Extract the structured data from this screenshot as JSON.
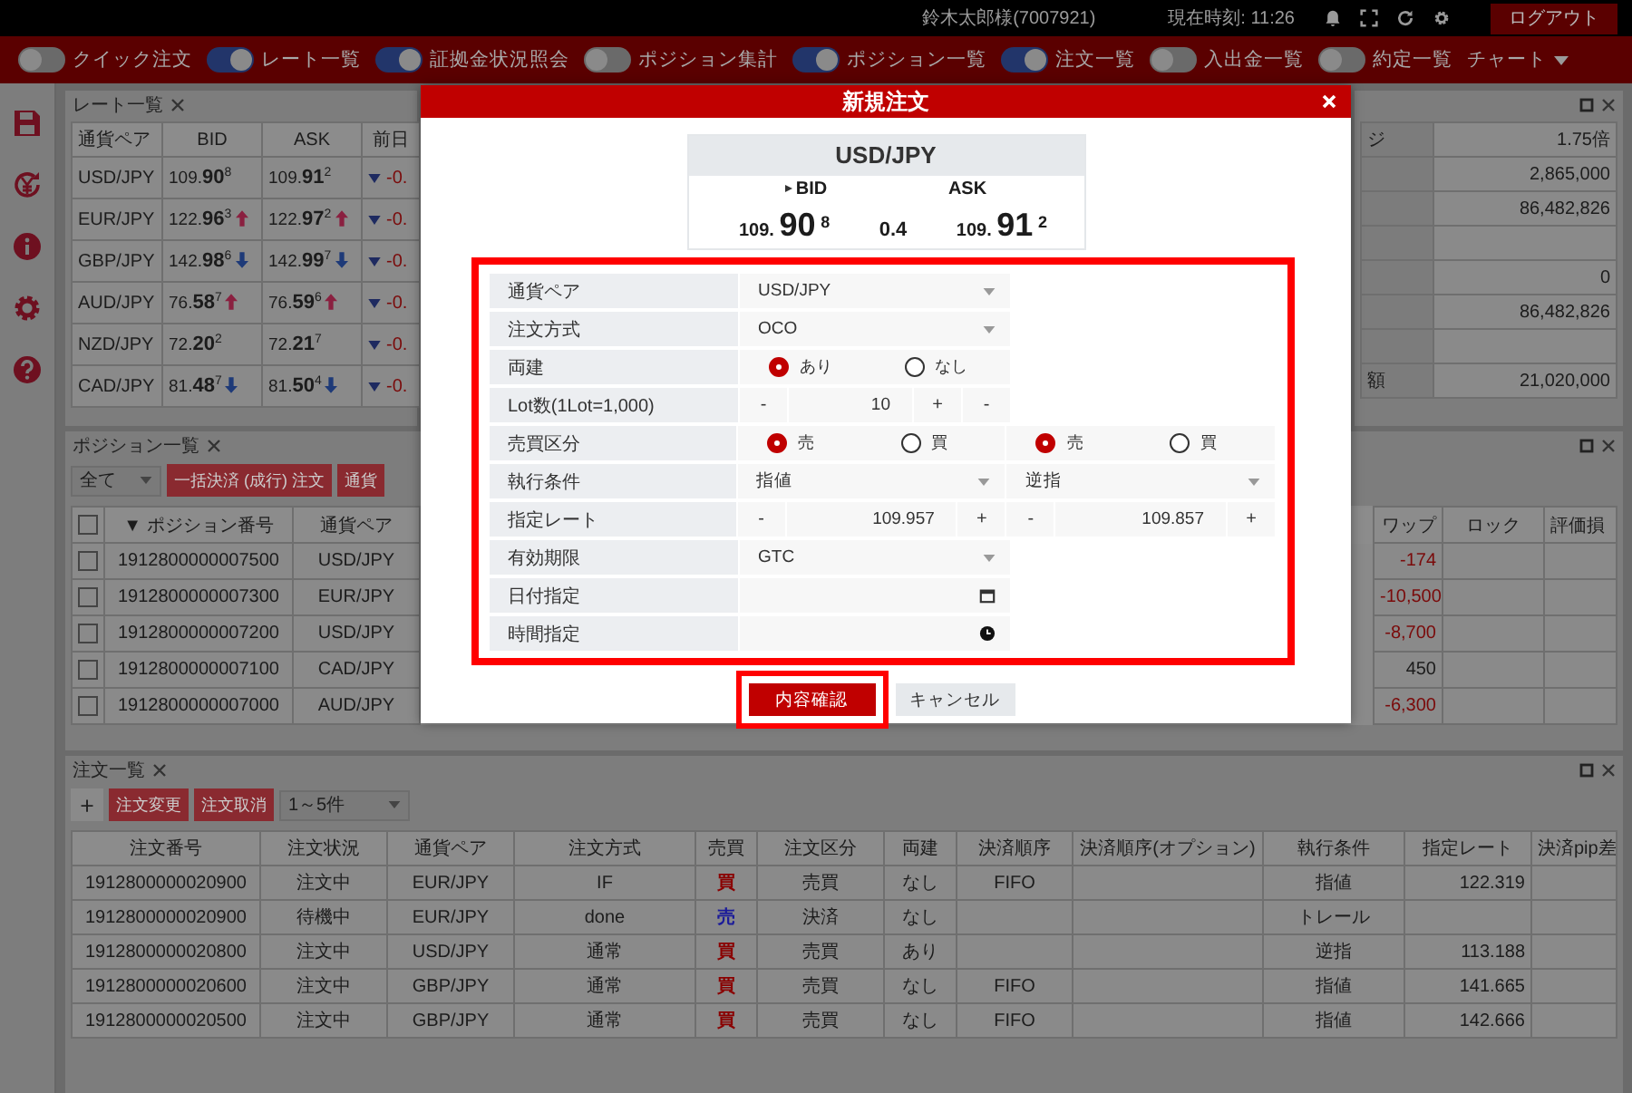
{
  "header": {
    "user": "鈴木太郎様(7007921)",
    "clock": "現在時刻: 11:26",
    "logout": "ログアウト"
  },
  "toolbar": [
    {
      "kind": "toggle",
      "label": "クイック注文",
      "on": false
    },
    {
      "kind": "toggle",
      "label": "レート一覧",
      "on": true
    },
    {
      "kind": "toggle",
      "label": "証拠金状況照会",
      "on": true
    },
    {
      "kind": "toggle",
      "label": "ポジション集計",
      "on": false
    },
    {
      "kind": "toggle",
      "label": "ポジション一覧",
      "on": true
    },
    {
      "kind": "toggle",
      "label": "注文一覧",
      "on": true
    },
    {
      "kind": "toggle",
      "label": "入出金一覧",
      "on": false
    },
    {
      "kind": "toggle",
      "label": "約定一覧",
      "on": false
    },
    {
      "kind": "menu",
      "label": "チャート"
    }
  ],
  "rate_panel": {
    "title": "レート一覧",
    "columns": [
      "通貨ペア",
      "BID",
      "ASK",
      "前日"
    ],
    "rows": [
      {
        "pair": "USD/JPY",
        "bid": "109.**90**$^{8}$",
        "bid_up": false,
        "bid_down": false,
        "ask": "109.**91**$^{2}$",
        "ask_up": false,
        "ask_down": false,
        "change": "-0."
      },
      {
        "pair": "EUR/JPY",
        "bid": "122.**96**$^{3}$",
        "bid_up": true,
        "bid_down": false,
        "ask": "122.**97**$^{2}$",
        "ask_up": true,
        "ask_down": false,
        "change": "-0."
      },
      {
        "pair": "GBP/JPY",
        "bid": "142.**98**$^{6}$",
        "bid_up": false,
        "bid_down": true,
        "ask": "142.**99**$^{7}$",
        "ask_up": false,
        "ask_down": true,
        "change": "-0."
      },
      {
        "pair": "AUD/JPY",
        "bid": "76.**58**$^{7}$",
        "bid_up": true,
        "bid_down": false,
        "ask": "76.**59**$^{6}$",
        "ask_up": true,
        "ask_down": false,
        "change": "-0."
      },
      {
        "pair": "NZD/JPY",
        "bid": "72.**20**$^{2}$",
        "bid_up": false,
        "bid_down": false,
        "ask": "72.**21**$^{7}$",
        "ask_up": false,
        "ask_down": false,
        "change": "-0."
      },
      {
        "pair": "CAD/JPY",
        "bid": "81.**48**$^{7}$",
        "bid_up": false,
        "bid_down": true,
        "ask": "81.**50**$^{4}$",
        "ask_up": false,
        "ask_down": true,
        "change": "-0."
      }
    ]
  },
  "account_panel": {
    "rows": [
      {
        "label": "ジ",
        "value": "1.75倍"
      },
      {
        "value": "2,865,000"
      },
      {
        "value": "86,482,826"
      },
      {},
      {
        "value": "0"
      },
      {
        "value": "86,482,826"
      },
      {},
      {
        "label": "額",
        "value": "21,020,000"
      }
    ]
  },
  "position_panel": {
    "title": "ポジション一覧",
    "filter": "全て",
    "all_checked": false,
    "buttons": [
      "一括決済 (成行) 注文",
      "通貨"
    ],
    "columns": [
      "▼ ポジション番号",
      "通貨ペア",
      "ワップ",
      "ロック",
      "評価損"
    ],
    "rows": [
      {
        "checked": false,
        "number": "1912800000007500",
        "pair": "USD/JPY",
        "swap": "-174",
        "color": "#7a0a0a"
      },
      {
        "checked": false,
        "number": "1912800000007300",
        "pair": "EUR/JPY",
        "swap": "-10,500",
        "color": "#7a0a0a"
      },
      {
        "checked": false,
        "number": "1912800000007200",
        "pair": "USD/JPY",
        "swap": "-8,700",
        "color": "#7a0a0a"
      },
      {
        "checked": false,
        "number": "1912800000007100",
        "pair": "CAD/JPY",
        "swap": "450",
        "color": "#1c1c1c"
      },
      {
        "checked": false,
        "number": "1912800000007000",
        "pair": "AUD/JPY",
        "swap": "-6,300",
        "color": "#7a0a0a"
      }
    ]
  },
  "order_panel": {
    "title": "注文一覧",
    "add": "+",
    "buttons": [
      "注文変更",
      "注文取消"
    ],
    "range": "1～5件",
    "columns": [
      "注文番号",
      "注文状況",
      "通貨ペア",
      "注文方式",
      "売買",
      "注文区分",
      "両建",
      "決済順序",
      "決済順序(オプション)",
      "執行条件",
      "指定レート",
      "決済pip差"
    ],
    "rows": [
      {
        "number": "1912800000020900",
        "status": "注文中",
        "pair": "EUR/JPY",
        "method": "IF",
        "side": "買",
        "color": "#8a0000",
        "category": "売買",
        "hedge": "なし",
        "settle": "FIFO",
        "condition": "指値",
        "rate": "122.319"
      },
      {
        "number": "1912800000020900",
        "status": "待機中",
        "pair": "EUR/JPY",
        "method": "done",
        "side": "売",
        "color": "#1a1a9a",
        "category": "決済",
        "hedge": "なし",
        "condition": "トレール"
      },
      {
        "number": "1912800000020800",
        "status": "注文中",
        "pair": "USD/JPY",
        "method": "通常",
        "side": "買",
        "color": "#8a0000",
        "category": "売買",
        "hedge": "あり",
        "condition": "逆指",
        "rate": "113.188"
      },
      {
        "number": "1912800000020600",
        "status": "注文中",
        "pair": "GBP/JPY",
        "method": "通常",
        "side": "買",
        "color": "#8a0000",
        "category": "売買",
        "hedge": "なし",
        "settle": "FIFO",
        "condition": "指値",
        "rate": "141.665"
      },
      {
        "number": "1912800000020500",
        "status": "注文中",
        "pair": "GBP/JPY",
        "method": "通常",
        "side": "買",
        "color": "#8a0000",
        "category": "売買",
        "hedge": "なし",
        "settle": "FIFO",
        "condition": "指値",
        "rate": "142.666"
      }
    ]
  },
  "modal": {
    "title": "新規注文",
    "quote": {
      "pair": "USD/JPY",
      "bid_label": "BID",
      "ask_label": "ASK",
      "bid_base": "109.",
      "bid_big": "90",
      "bid_pip": "8",
      "spread": "0.4",
      "ask_base": "109.",
      "ask_big": "91",
      "ask_pip": "2"
    },
    "form": [
      {
        "label": "通貨ペア",
        "controls": [
          {
            "kind": "select",
            "value": "USD/JPY"
          }
        ]
      },
      {
        "label": "注文方式",
        "controls": [
          {
            "kind": "select",
            "value": "OCO"
          }
        ]
      },
      {
        "label": "両建",
        "controls": [
          {
            "kind": "radio",
            "options": [
              {
                "label": "あり",
                "selected": true
              },
              {
                "label": "なし",
                "selected": false
              }
            ]
          }
        ]
      },
      {
        "label": "Lot数(1Lot=1,000)",
        "controls": [
          {
            "kind": "stepper",
            "minus": "-",
            "value": "10",
            "plus": "+",
            "extra": "-"
          }
        ]
      },
      {
        "label": "売買区分",
        "controls": [
          {
            "kind": "radio",
            "options": [
              {
                "label": "売",
                "selected": true
              },
              {
                "label": "買",
                "selected": false
              }
            ]
          },
          {
            "kind": "radio",
            "options": [
              {
                "label": "売",
                "selected": true
              },
              {
                "label": "買",
                "selected": false
              }
            ]
          }
        ]
      },
      {
        "label": "執行条件",
        "controls": [
          {
            "kind": "select",
            "value": "指値"
          },
          {
            "kind": "select",
            "value": "逆指"
          }
        ]
      },
      {
        "label": "指定レート",
        "controls": [
          {
            "kind": "stepper",
            "minus": "-",
            "value": "109.957",
            "plus": "+"
          },
          {
            "kind": "stepper",
            "minus": "-",
            "value": "109.857",
            "plus": "+"
          }
        ]
      },
      {
        "label": "有効期限",
        "controls": [
          {
            "kind": "select",
            "value": "GTC"
          }
        ]
      },
      {
        "label": "日付指定",
        "controls": [
          {
            "kind": "date"
          }
        ]
      },
      {
        "label": "時間指定",
        "controls": [
          {
            "kind": "time"
          }
        ]
      }
    ],
    "confirm": "内容確認",
    "cancel": "キャンセル"
  }
}
